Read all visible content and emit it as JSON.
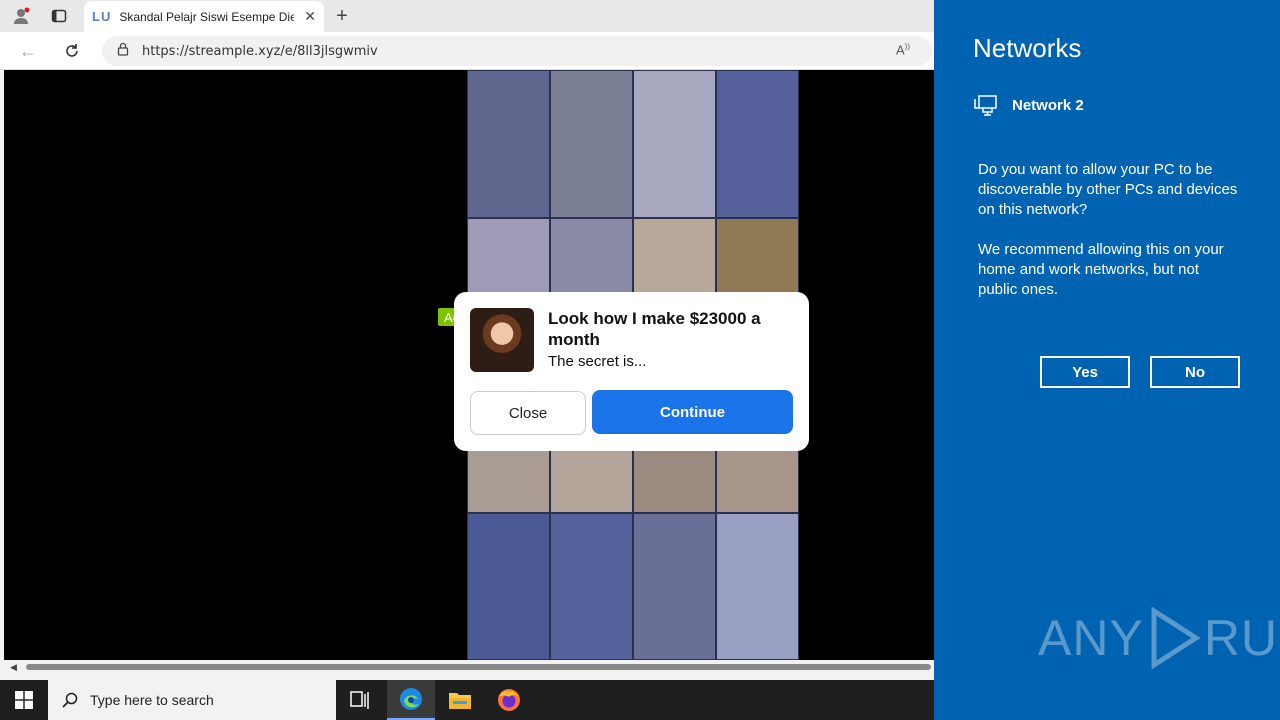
{
  "browser": {
    "tab": {
      "favicon_text": "LU",
      "title": "Skandal Pelajr Siswi Esempe Dievi"
    },
    "url": "https://streample.xyz/e/8ll3jlsgwmiv"
  },
  "ad": {
    "badge": "Ad",
    "title": "Look how I make $23000 a month",
    "subtitle": "The secret is...",
    "close_label": "Close",
    "continue_label": "Continue"
  },
  "network_panel": {
    "title": "Networks",
    "network_name": "Network 2",
    "question": "Do you want to allow your PC to be discoverable by other PCs and devices on this network?",
    "recommendation": "We recommend allowing this on your home and work networks, but not public ones.",
    "yes_label": "Yes",
    "no_label": "No",
    "watermark_left": "ANY",
    "watermark_right": "RUN"
  },
  "taskbar": {
    "search_placeholder": "Type here to search",
    "apps": [
      "task-view",
      "edge",
      "file-explorer",
      "firefox"
    ]
  },
  "colors": {
    "panel_blue": "#0063b1",
    "ad_badge": "#7cc400",
    "continue_blue": "#1a73e8"
  }
}
